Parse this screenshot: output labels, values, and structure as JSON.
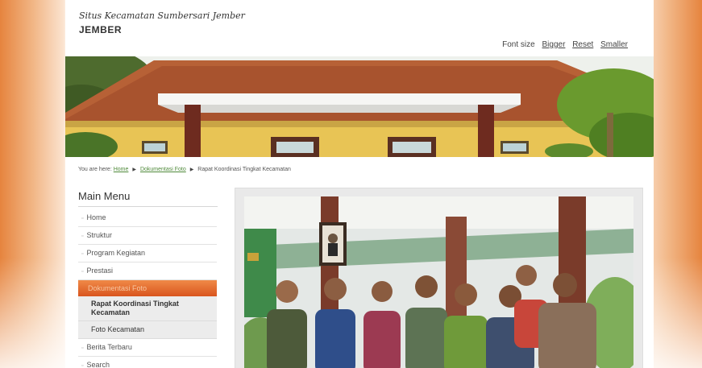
{
  "site": {
    "tagline": "Situs Kecamatan Sumbersari Jember",
    "name": "JEMBER"
  },
  "font_size": {
    "label": "Font size",
    "bigger": "Bigger",
    "reset": "Reset",
    "smaller": "Smaller"
  },
  "breadcrumb": {
    "prefix": "You are here:",
    "items": [
      "Home",
      "Dokumentasi Foto",
      "Rapat Koordinasi Tingkat Kecamatan"
    ]
  },
  "menu": {
    "title": "Main Menu",
    "items": [
      "Home",
      "Struktur",
      "Program Kegiatan",
      "Prestasi",
      "Dokumentasi Foto",
      "Rapat Koordinasi Tingkat Kecamatan",
      "Foto Kecamatan",
      "Berita Terbaru",
      "Search"
    ]
  },
  "colors": {
    "accent": "#e0652c",
    "link": "#4f8a3a",
    "side_orange": "#e6843e"
  }
}
